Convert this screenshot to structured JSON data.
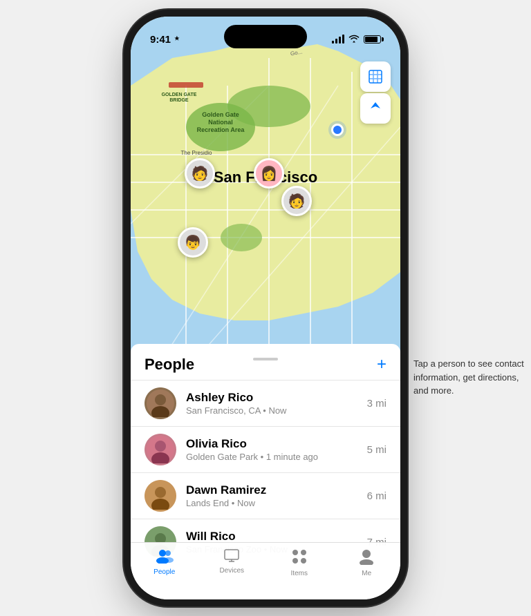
{
  "status_bar": {
    "time": "9:41",
    "location_arrow": "▲"
  },
  "map": {
    "city_label": "San Francisco"
  },
  "map_buttons": {
    "map_icon": "🗺",
    "location_icon": "➤"
  },
  "people_section": {
    "title": "People",
    "add_label": "+"
  },
  "people": [
    {
      "name": "Ashley Rico",
      "location": "San Francisco, CA",
      "time": "Now",
      "distance": "3 mi",
      "emoji": "🧑"
    },
    {
      "name": "Olivia Rico",
      "location": "Golden Gate Park",
      "time": "1 minute ago",
      "distance": "5 mi",
      "emoji": "👩"
    },
    {
      "name": "Dawn Ramirez",
      "location": "Lands End",
      "time": "Now",
      "distance": "6 mi",
      "emoji": "🧑"
    },
    {
      "name": "Will Rico",
      "location": "San Francisco Zoo",
      "time": "Now",
      "distance": "7 mi",
      "emoji": "👦"
    }
  ],
  "tabs": [
    {
      "label": "People",
      "icon": "👥",
      "active": true
    },
    {
      "label": "Devices",
      "icon": "🖥",
      "active": false
    },
    {
      "label": "Items",
      "icon": "⠿",
      "active": false
    },
    {
      "label": "Me",
      "icon": "👤",
      "active": false
    }
  ],
  "annotation": {
    "text": "Tap a person to see contact information, get directions, and more."
  }
}
